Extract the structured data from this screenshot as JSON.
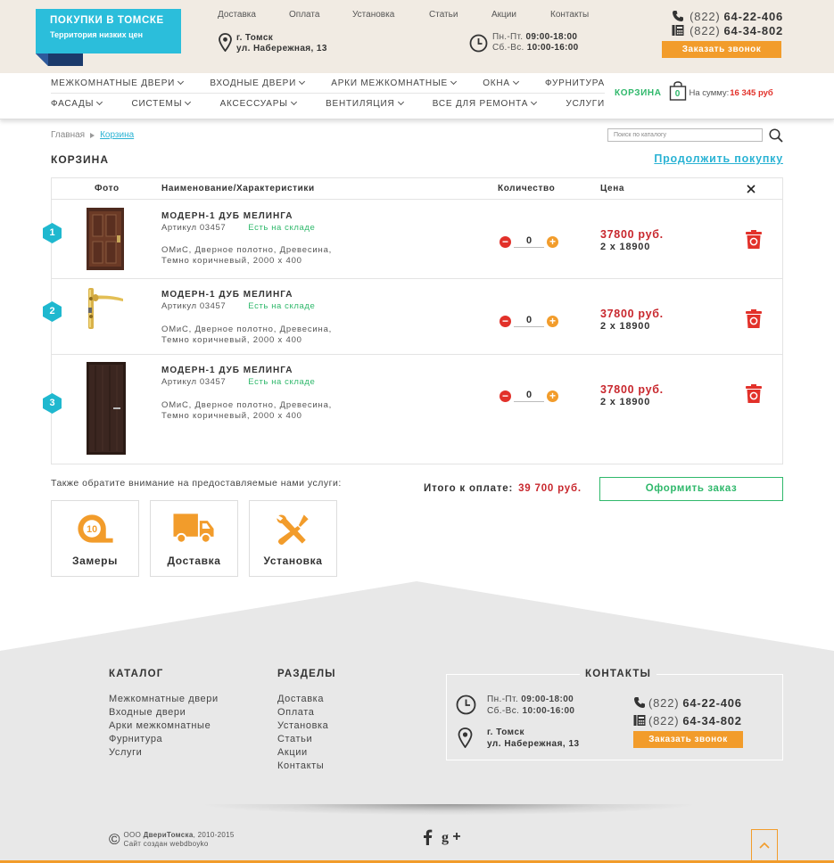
{
  "header": {
    "logo_title": "ПОКУПКИ В ТОМСКЕ",
    "logo_subtitle": "Территория низких цен",
    "top_links": [
      "Доставка",
      "Оплата",
      "Установка",
      "Статьи",
      "Акции",
      "Контакты"
    ],
    "address_line1": "г. Томск",
    "address_line2": "ул. Набережная, 13",
    "hours_line1_label": "Пн.-Пт.",
    "hours_line1_value": "09:00-18:00",
    "hours_line2_label": "Сб.-Вс.",
    "hours_line2_value": "10:00-16:00",
    "phone1_code": "(822)",
    "phone1_number": "64-22-406",
    "phone2_code": "(822)",
    "phone2_number": "64-34-802",
    "call_button": "Заказать звонок"
  },
  "nav": {
    "row1": [
      "МЕЖКОМНАТНЫЕ ДВЕРИ",
      "ВХОДНЫЕ ДВЕРИ",
      "АРКИ МЕЖКОМНАТНЫЕ",
      "ОКНА",
      "ФУРНИТУРА"
    ],
    "row1_dropdown": [
      true,
      true,
      true,
      true,
      false
    ],
    "row2": [
      "ФАСАДЫ",
      "СИСТЕМЫ",
      "АКСЕССУАРЫ",
      "ВЕНТИЛЯЦИЯ",
      "ВСЕ ДЛЯ РЕМОНТА",
      "УСЛУГИ"
    ],
    "row2_dropdown": [
      true,
      true,
      true,
      true,
      true,
      false
    ],
    "cart_label": "КОРЗИНА",
    "cart_count": "0",
    "cart_sum_label": "На сумму:",
    "cart_sum": "16 345 руб"
  },
  "breadcrumb": {
    "home": "Главная",
    "current": "Корзина"
  },
  "search": {
    "placeholder": "Поиск по каталогу"
  },
  "page": {
    "title": "КОРЗИНА",
    "continue_link": "Продолжить покупку"
  },
  "table": {
    "headers": {
      "photo": "Фото",
      "name": "Наименование/Характеристики",
      "qty": "Количество",
      "price": "Цена"
    },
    "rows": [
      {
        "num": "1",
        "name": "МОДЕРН-1 ДУБ МЕЛИНГА",
        "article": "Артикул 03457",
        "stock": "Есть на складе",
        "desc1": "ОМиС, Дверное полотно, Древесина,",
        "desc2": "Темно коричневый, 2000 х 400",
        "qty": "0",
        "total": "37800 руб.",
        "calc": "2 x 18900",
        "image": "entrance-door"
      },
      {
        "num": "2",
        "name": "МОДЕРН-1 ДУБ МЕЛИНГА",
        "article": "Артикул 03457",
        "stock": "Есть на складе",
        "desc1": "ОМиС, Дверное полотно, Древесина,",
        "desc2": "Темно коричневый, 2000 х 400",
        "qty": "0",
        "total": "37800 руб.",
        "calc": "2 x 18900",
        "image": "door-handle"
      },
      {
        "num": "3",
        "name": "МОДЕРН-1 ДУБ МЕЛИНГА",
        "article": "Артикул 03457",
        "stock": "Есть на складе",
        "desc1": "ОМиС, Дверное полотно, Древесина,",
        "desc2": "Темно коричневый, 2000 х 400",
        "qty": "0",
        "total": "37800 руб.",
        "calc": "2 x 18900",
        "image": "interior-door"
      }
    ]
  },
  "services": {
    "note": "Также обратите внимание на предоставляемые нами услуги:",
    "items": [
      {
        "label": "Замеры",
        "icon": "tape-measure-icon"
      },
      {
        "label": "Доставка",
        "icon": "truck-icon"
      },
      {
        "label": "Установка",
        "icon": "tools-icon"
      }
    ]
  },
  "checkout": {
    "total_label": "Итого к оплате:",
    "total_value": "39 700 руб.",
    "order_button": "Оформить заказ"
  },
  "footer": {
    "catalog_title": "КАТАЛОГ",
    "catalog_items": [
      "Межкомнатные двери",
      "Входные двери",
      "Арки межкомнатные",
      "Фурнитура",
      "Услуги"
    ],
    "sections_title": "РАЗДЕЛЫ",
    "sections_items": [
      "Доставка",
      "Оплата",
      "Установка",
      "Статьи",
      "Акции",
      "Контакты"
    ],
    "contacts_title": "КОНТАКТЫ",
    "copyright_line1_prefix": "ООО",
    "copyright_brand": "ДвериТомска",
    "copyright_years": ", 2010-2015",
    "copyright_line2": "Сайт создан webdboyko"
  },
  "colors": {
    "accent_orange": "#f29c2b",
    "accent_cyan": "#2bbedb",
    "price_red": "#c8272d",
    "stock_green": "#2fb86b",
    "header_bg": "#f1ebe3",
    "footer_bg": "#e8e8e8"
  }
}
